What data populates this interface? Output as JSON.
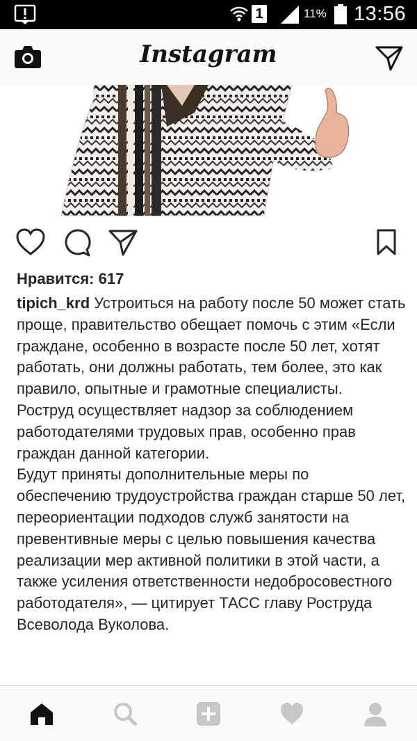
{
  "status_bar": {
    "sim_label": "1",
    "battery_percent": "11%",
    "time": "13:56",
    "icons": [
      "notification-alert-icon",
      "wifi-icon",
      "signal-icon",
      "battery-icon"
    ]
  },
  "header": {
    "title": "Instagram",
    "left_icon": "camera-icon",
    "right_icon": "direct-message-icon"
  },
  "post": {
    "likes_text": "Нравится: 617",
    "username": "tipich_krd",
    "caption_paragraphs": [
      "Устроиться на работу после 50 может стать проще, правительство обещает помочь с этим «Если граждане, особенно в возрасте после 50 лет, хотят работать, они должны работать, тем более, это как правило, опытные и грамотные специалисты.",
      "Роструд осуществляет надзор за соблюдением работодателями трудовых прав, особенно прав граждан данной категории.",
      "Будут приняты дополнительные меры по обеспечению трудоустройства граждан старше 50 лет, переориентации подходов служб занятости на превентивные меры с целью повышения качества реализации мер активной политики в этой части, а также усиления ответственности недобросовестного работодателя», — цитирует ТАСС главу Роструда Всеволода Вуколова."
    ],
    "action_icons": [
      "heart-icon",
      "comment-icon",
      "share-icon",
      "bookmark-icon"
    ]
  },
  "bottom_nav": {
    "items": [
      "home-icon",
      "search-icon",
      "add-post-icon",
      "activity-heart-icon",
      "profile-icon"
    ],
    "active": "home-icon"
  },
  "colors": {
    "status_bar": "#000000",
    "header_bg": "#fafafa",
    "text": "#262626",
    "inactive_icon": "#c7c7c7"
  }
}
